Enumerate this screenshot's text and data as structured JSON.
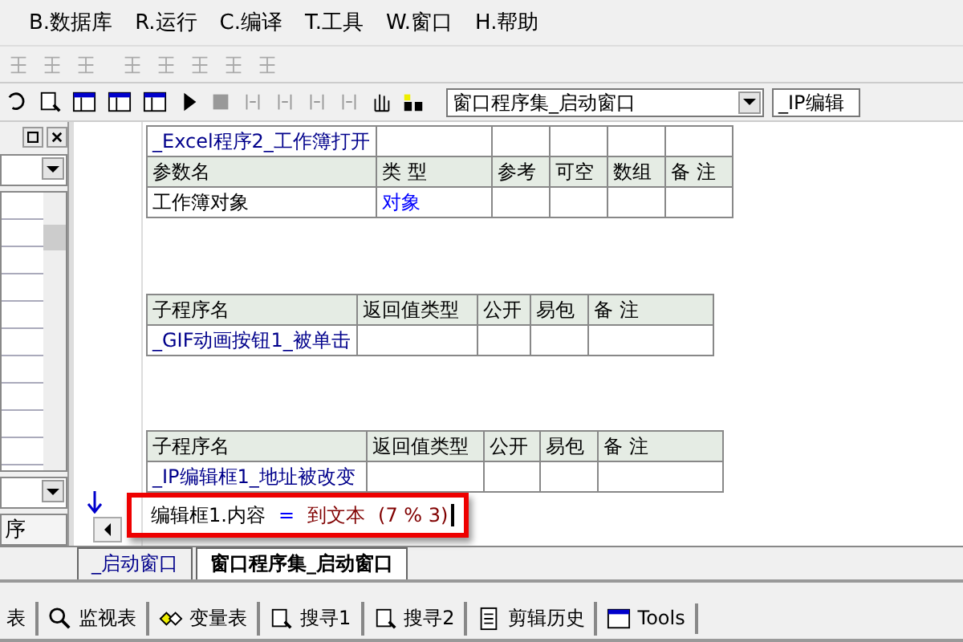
{
  "menu": [
    "B.数据库",
    "R.运行",
    "C.编译",
    "T.工具",
    "W.窗口",
    "H.帮助"
  ],
  "toolbar": {
    "procedure_select": "窗口程序集_启动窗口",
    "sub_select": "_IP编辑"
  },
  "left_panel": {
    "tab": "序"
  },
  "tables": [
    {
      "title": "_Excel程序2_工作簿打开",
      "columns": [
        "参数名",
        "类 型",
        "参考",
        "可空",
        "数组",
        "备 注"
      ],
      "rows": [
        [
          "工作簿对象",
          "对象",
          "",
          "",
          "",
          ""
        ]
      ]
    },
    {
      "columns": [
        "子程序名",
        "返回值类型",
        "公开",
        "易包",
        "备 注"
      ],
      "rows": [
        [
          "_GIF动画按钮1_被单击",
          "",
          "",
          "",
          ""
        ]
      ]
    },
    {
      "columns": [
        "子程序名",
        "返回值类型",
        "公开",
        "易包",
        "备 注"
      ],
      "rows": [
        [
          "_IP编辑框1_地址被改变",
          "",
          "",
          "",
          ""
        ]
      ]
    }
  ],
  "code_line": {
    "target": "编辑框1.内容",
    "op": "=",
    "call": "到文本",
    "args": "(7 % 3)",
    "highlighted": true
  },
  "editor_tabs": [
    {
      "label": "_启动窗口",
      "selected": false
    },
    {
      "label": "窗口程序集_启动窗口",
      "selected": true
    }
  ],
  "bottom_tabs": [
    {
      "label": "表",
      "kind": "none"
    },
    {
      "label": "监视表",
      "kind": "search"
    },
    {
      "label": "变量表",
      "kind": "vars"
    },
    {
      "label": "搜寻1",
      "kind": "find"
    },
    {
      "label": "搜寻2",
      "kind": "find"
    },
    {
      "label": "剪辑历史",
      "kind": "doc"
    },
    {
      "label": "Tools",
      "kind": "window"
    }
  ]
}
